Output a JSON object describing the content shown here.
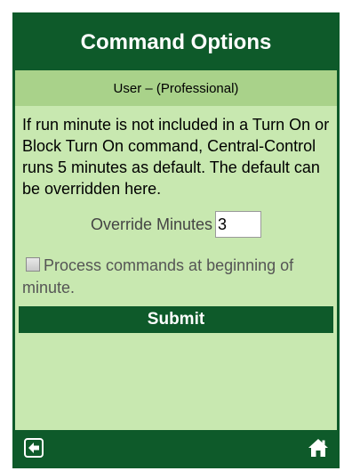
{
  "header": {
    "title": "Command Options",
    "subtitle": "User – (Professional)"
  },
  "main": {
    "description": "If run minute is not included in a Turn On or Block Turn On command, Central-Control runs 5 minutes as default. The default can be overridden here.",
    "override": {
      "label": "Override Minutes",
      "value": "3"
    },
    "process_option": {
      "label": "Process commands at beginning of minute.",
      "checked": false
    },
    "submit_label": "Submit"
  },
  "footer": {
    "back_icon": "back-arrow-icon",
    "home_icon": "home-icon"
  },
  "colors": {
    "primary": "#0e5a2a",
    "panel_background": "#c8e8b0",
    "subtitle_background": "#a9d28a"
  }
}
